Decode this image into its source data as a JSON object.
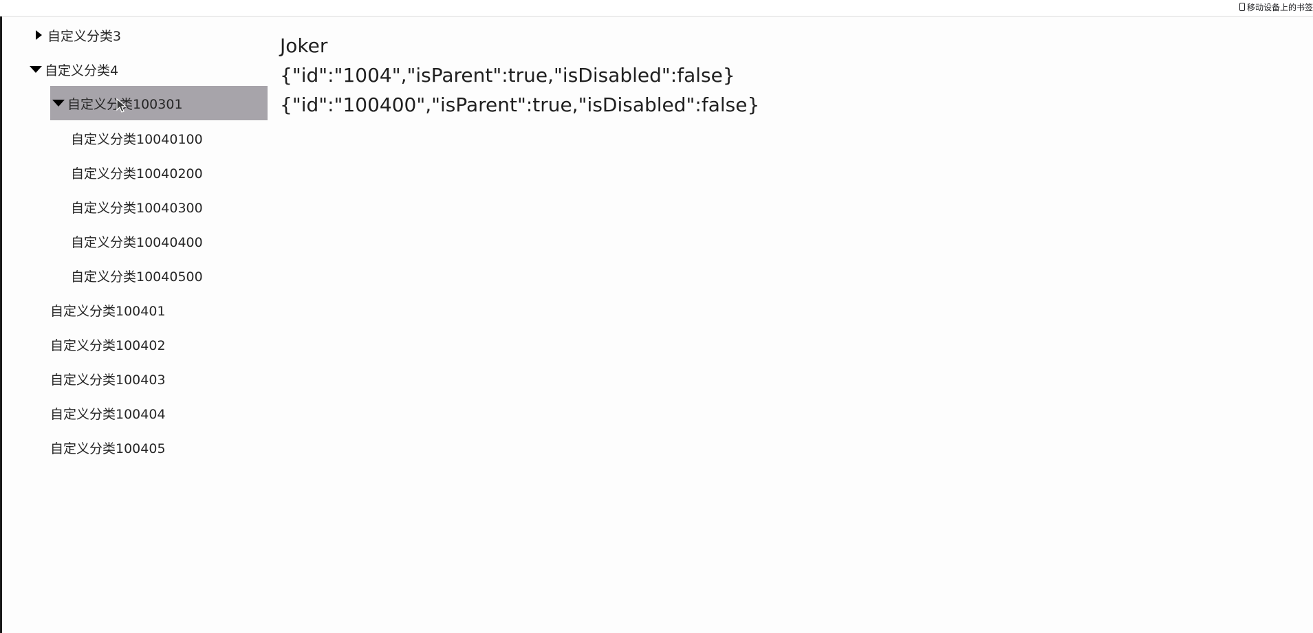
{
  "browser": {
    "bookmark_label": "移动设备上的书签"
  },
  "tree": {
    "nodes": [
      {
        "label": "自定义分类3",
        "caret": "right"
      },
      {
        "label": "自定义分类4",
        "caret": "down"
      },
      {
        "label": "自定义分类100301",
        "caret": "down",
        "selected": true
      },
      {
        "label": "自定义分类10040100"
      },
      {
        "label": "自定义分类10040200"
      },
      {
        "label": "自定义分类10040300"
      },
      {
        "label": "自定义分类10040400"
      },
      {
        "label": "自定义分类10040500"
      },
      {
        "label": "自定义分类100401"
      },
      {
        "label": "自定义分类100402"
      },
      {
        "label": "自定义分类100403"
      },
      {
        "label": "自定义分类100404"
      },
      {
        "label": "自定义分类100405"
      }
    ]
  },
  "info": {
    "name": "Joker",
    "line1": "{\"id\":\"1004\",\"isParent\":true,\"isDisabled\":false}",
    "line2": "{\"id\":\"100400\",\"isParent\":true,\"isDisabled\":false}"
  },
  "colors": {
    "selected_bg": "#a7a4aa"
  }
}
